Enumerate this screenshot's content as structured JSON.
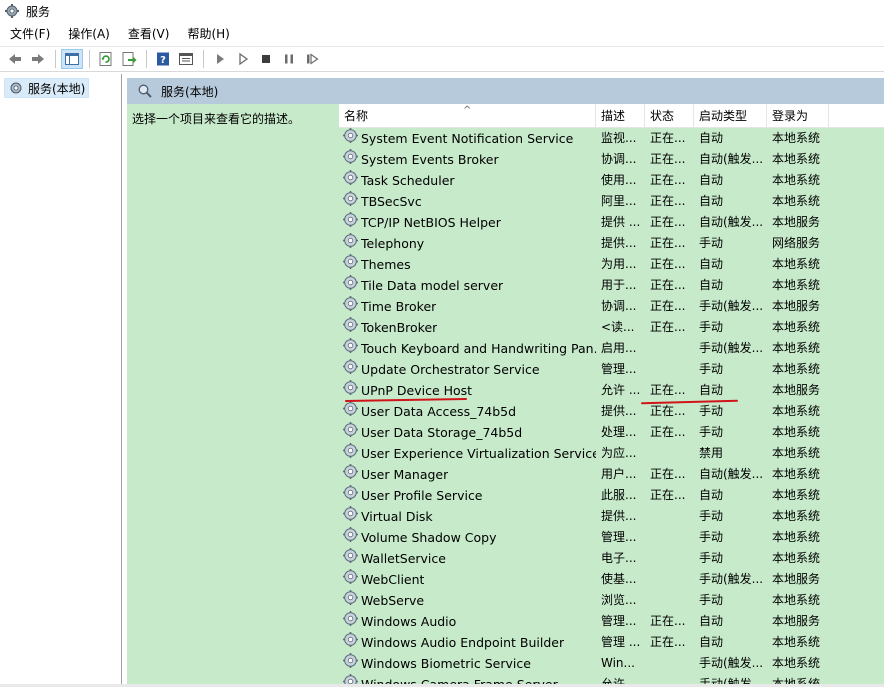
{
  "window": {
    "title": "服务",
    "icon": "gear-icon"
  },
  "menu": [
    "文件(F)",
    "操作(A)",
    "查看(V)",
    "帮助(H)"
  ],
  "toolbar": {
    "buttons": [
      "back-arrow-icon",
      "forward-arrow-icon",
      "console-tree-icon",
      "refresh-icon",
      "export-icon",
      "help-icon",
      "properties-icon",
      "start-icon",
      "start-alt-icon",
      "stop-icon",
      "pause-icon",
      "restart-icon"
    ]
  },
  "tree": {
    "root_label": "服务(本地)"
  },
  "content": {
    "header_label": "服务(本地)",
    "description_hint": "选择一个项目来查看它的描述。"
  },
  "columns": {
    "name": "名称",
    "desc": "描述",
    "status": "状态",
    "start": "启动类型",
    "logon": "登录为"
  },
  "services": [
    {
      "name": "System Event Notification Service",
      "desc": "监视...",
      "status": "正在...",
      "start": "自动",
      "logon": "本地系统"
    },
    {
      "name": "System Events Broker",
      "desc": "协调...",
      "status": "正在...",
      "start": "自动(触发...",
      "logon": "本地系统"
    },
    {
      "name": "Task Scheduler",
      "desc": "使用...",
      "status": "正在...",
      "start": "自动",
      "logon": "本地系统"
    },
    {
      "name": "TBSecSvc",
      "desc": "阿里...",
      "status": "正在...",
      "start": "自动",
      "logon": "本地系统"
    },
    {
      "name": "TCP/IP NetBIOS Helper",
      "desc": "提供 ...",
      "status": "正在...",
      "start": "自动(触发...",
      "logon": "本地服务"
    },
    {
      "name": "Telephony",
      "desc": "提供...",
      "status": "正在...",
      "start": "手动",
      "logon": "网络服务"
    },
    {
      "name": "Themes",
      "desc": "为用...",
      "status": "正在...",
      "start": "自动",
      "logon": "本地系统"
    },
    {
      "name": "Tile Data model server",
      "desc": "用于...",
      "status": "正在...",
      "start": "自动",
      "logon": "本地系统"
    },
    {
      "name": "Time Broker",
      "desc": "协调...",
      "status": "正在...",
      "start": "手动(触发...",
      "logon": "本地服务"
    },
    {
      "name": "TokenBroker",
      "desc": "<读...",
      "status": "正在...",
      "start": "手动",
      "logon": "本地系统"
    },
    {
      "name": "Touch Keyboard and Handwriting Pan...",
      "desc": "启用...",
      "status": "",
      "start": "手动(触发...",
      "logon": "本地系统"
    },
    {
      "name": "Update Orchestrator Service",
      "desc": "管理...",
      "status": "",
      "start": "手动",
      "logon": "本地系统"
    },
    {
      "name": "UPnP Device Host",
      "desc": "允许 ...",
      "status": "正在...",
      "start": "自动",
      "logon": "本地服务"
    },
    {
      "name": "User Data Access_74b5d",
      "desc": "提供...",
      "status": "正在...",
      "start": "手动",
      "logon": "本地系统"
    },
    {
      "name": "User Data Storage_74b5d",
      "desc": "处理...",
      "status": "正在...",
      "start": "手动",
      "logon": "本地系统"
    },
    {
      "name": "User Experience Virtualization Service",
      "desc": "为应...",
      "status": "",
      "start": "禁用",
      "logon": "本地系统"
    },
    {
      "name": "User Manager",
      "desc": "用户...",
      "status": "正在...",
      "start": "自动(触发...",
      "logon": "本地系统"
    },
    {
      "name": "User Profile Service",
      "desc": "此服...",
      "status": "正在...",
      "start": "自动",
      "logon": "本地系统"
    },
    {
      "name": "Virtual Disk",
      "desc": "提供...",
      "status": "",
      "start": "手动",
      "logon": "本地系统"
    },
    {
      "name": "Volume Shadow Copy",
      "desc": "管理...",
      "status": "",
      "start": "手动",
      "logon": "本地系统"
    },
    {
      "name": "WalletService",
      "desc": "电子...",
      "status": "",
      "start": "手动",
      "logon": "本地系统"
    },
    {
      "name": "WebClient",
      "desc": "使基...",
      "status": "",
      "start": "手动(触发...",
      "logon": "本地服务"
    },
    {
      "name": "WebServe",
      "desc": "浏览...",
      "status": "",
      "start": "手动",
      "logon": "本地系统"
    },
    {
      "name": "Windows Audio",
      "desc": "管理...",
      "status": "正在...",
      "start": "自动",
      "logon": "本地服务"
    },
    {
      "name": "Windows Audio Endpoint Builder",
      "desc": "管理 ...",
      "status": "正在...",
      "start": "自动",
      "logon": "本地系统"
    },
    {
      "name": "Windows Biometric Service",
      "desc": "Win...",
      "status": "",
      "start": "手动(触发...",
      "logon": "本地系统"
    },
    {
      "name": "Windows Camera Frame Server",
      "desc": "允许...",
      "status": "",
      "start": "手动(触发...",
      "logon": "本地系统"
    }
  ],
  "colors": {
    "list_bg": "#c7eacb",
    "header_bg": "#b7cadb",
    "annotation": "#d0141a"
  }
}
